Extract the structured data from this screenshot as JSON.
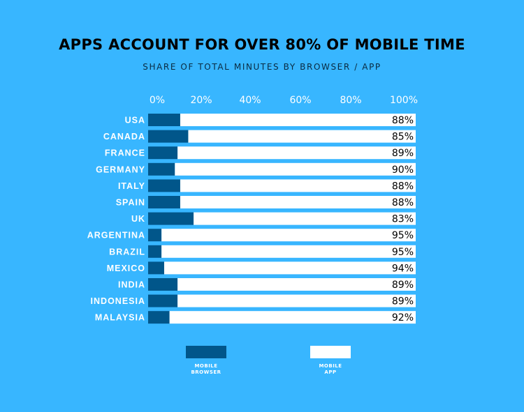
{
  "chart_data": {
    "type": "bar",
    "orientation": "horizontal",
    "stacked": true,
    "title": "APPS ACCOUNT FOR OVER 80% OF MOBILE TIME",
    "subtitle": "SHARE OF TOTAL MINUTES BY BROWSER / APP",
    "xlim": [
      0,
      100
    ],
    "x_ticks": [
      "0%",
      "20%",
      "40%",
      "60%",
      "80%",
      "100%"
    ],
    "categories": [
      "USA",
      "CANADA",
      "FRANCE",
      "GERMANY",
      "ITALY",
      "SPAIN",
      "UK",
      "ARGENTINA",
      "BRAZIL",
      "MEXICO",
      "INDIA",
      "INDONESIA",
      "MALAYSIA"
    ],
    "series": [
      {
        "name": "MOBILE BROWSER",
        "color": "#01568a",
        "values": [
          12,
          15,
          11,
          10,
          12,
          12,
          17,
          5,
          5,
          6,
          11,
          11,
          8
        ]
      },
      {
        "name": "MOBILE APP",
        "color": "#ffffff",
        "values": [
          88,
          85,
          89,
          90,
          88,
          88,
          83,
          95,
          95,
          94,
          89,
          89,
          92
        ]
      }
    ],
    "data_labels": [
      "88%",
      "85%",
      "89%",
      "90%",
      "88%",
      "88%",
      "83%",
      "95%",
      "95%",
      "94%",
      "89%",
      "89%",
      "92%"
    ],
    "legend": {
      "placement": "bottom",
      "entries": [
        [
          "MOBILE",
          "BROWSER"
        ],
        [
          "MOBILE",
          "APP"
        ]
      ]
    },
    "grid": false,
    "background": "#38b6ff"
  }
}
